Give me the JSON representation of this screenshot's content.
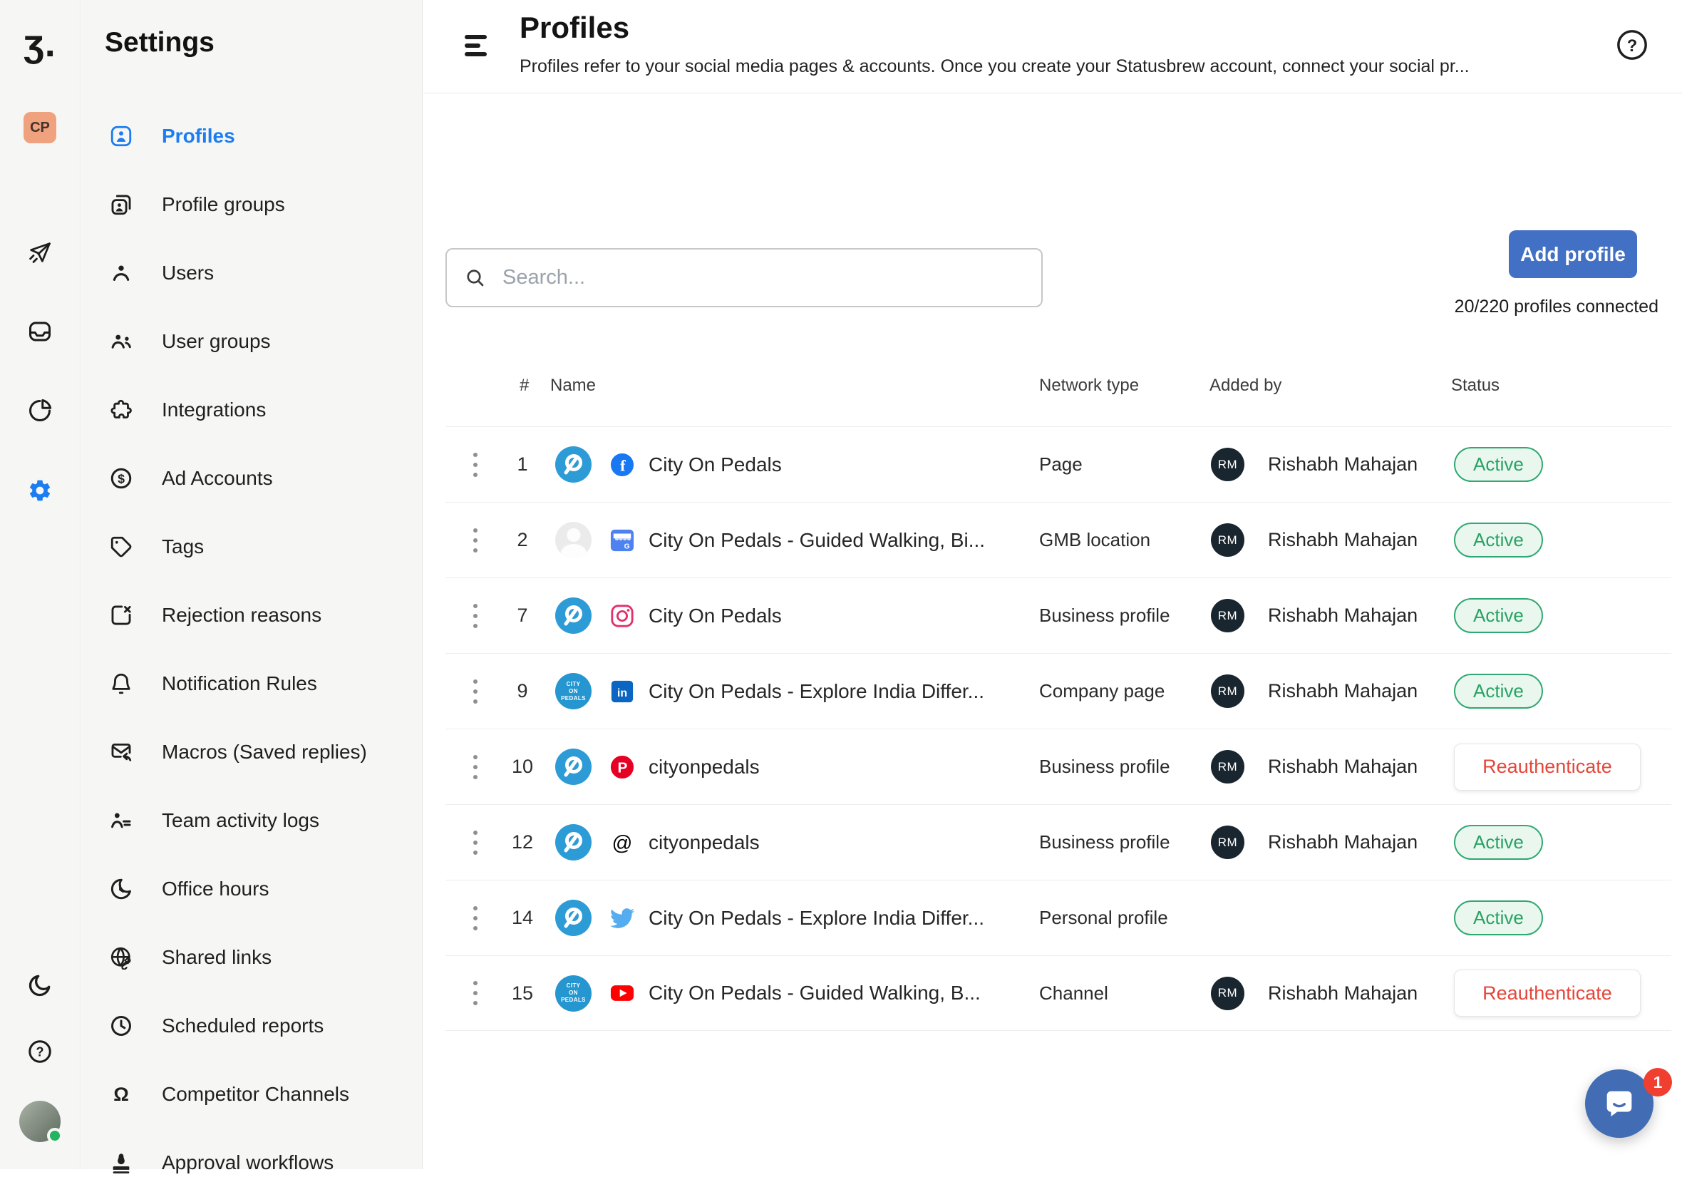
{
  "app": {
    "logo_glyph": "ʒ."
  },
  "rail": {
    "workspace_badge": "CP",
    "icons": [
      "paper-plane-icon",
      "inbox-icon",
      "pie-chart-icon",
      "gear-icon",
      "moon-icon",
      "help-icon",
      "user-avatar"
    ]
  },
  "sidebar": {
    "title": "Settings",
    "items": [
      {
        "label": "Profiles",
        "icon": "person-card",
        "active": true
      },
      {
        "label": "Profile groups",
        "icon": "profile-cards"
      },
      {
        "label": "Users",
        "icon": "user"
      },
      {
        "label": "User groups",
        "icon": "user-group"
      },
      {
        "label": "Integrations",
        "icon": "puzzle"
      },
      {
        "label": "Ad Accounts",
        "icon": "dollar-circle"
      },
      {
        "label": "Tags",
        "icon": "tag"
      },
      {
        "label": "Rejection reasons",
        "icon": "box-x"
      },
      {
        "label": "Notification Rules",
        "icon": "bell"
      },
      {
        "label": "Macros (Saved replies)",
        "icon": "envelope-reply"
      },
      {
        "label": "Team activity logs",
        "icon": "person-activity"
      },
      {
        "label": "Office hours",
        "icon": "clock-moon"
      },
      {
        "label": "Shared links",
        "icon": "globe-link"
      },
      {
        "label": "Scheduled reports",
        "icon": "clock"
      },
      {
        "label": "Competitor Channels",
        "icon": "bust"
      },
      {
        "label": "Approval workflows",
        "icon": "stamp"
      }
    ]
  },
  "header": {
    "title": "Profiles",
    "subtitle": "Profiles refer to your social media pages & accounts. Once you create your Statusbrew account, connect your social pr..."
  },
  "toolbar": {
    "search_placeholder": "Search...",
    "add_profile_label": "Add profile",
    "connected_count": "20/220 profiles connected"
  },
  "table": {
    "columns": [
      "#",
      "Name",
      "Network type",
      "Added by",
      "Status"
    ],
    "avatar_text_lines": [
      "CITY",
      "ON",
      "PEDALS"
    ],
    "rows": [
      {
        "num": "1",
        "avatar": "logo",
        "network": "facebook",
        "name": "City On Pedals",
        "network_type": "Page",
        "added_by": "Rishabh Mahajan",
        "added_by_initials": "RM",
        "status": "Active",
        "status_kind": "active"
      },
      {
        "num": "2",
        "avatar": "placeholder",
        "network": "gmb",
        "name": "City On Pedals - Guided Walking, Bi...",
        "network_type": "GMB location",
        "added_by": "Rishabh Mahajan",
        "added_by_initials": "RM",
        "status": "Active",
        "status_kind": "active"
      },
      {
        "num": "7",
        "avatar": "logo",
        "network": "instagram",
        "name": "City On Pedals",
        "network_type": "Business profile",
        "added_by": "Rishabh Mahajan",
        "added_by_initials": "RM",
        "status": "Active",
        "status_kind": "active"
      },
      {
        "num": "9",
        "avatar": "cop-text",
        "network": "linkedin",
        "name": "City On Pedals - Explore India Differ...",
        "network_type": "Company page",
        "added_by": "Rishabh Mahajan",
        "added_by_initials": "RM",
        "status": "Active",
        "status_kind": "active"
      },
      {
        "num": "10",
        "avatar": "logo",
        "network": "pinterest",
        "name": "cityonpedals",
        "network_type": "Business profile",
        "added_by": "Rishabh Mahajan",
        "added_by_initials": "RM",
        "status": "Reauthenticate",
        "status_kind": "reauth"
      },
      {
        "num": "12",
        "avatar": "logo",
        "network": "threads",
        "name": "cityonpedals",
        "network_type": "Business profile",
        "added_by": "Rishabh Mahajan",
        "added_by_initials": "RM",
        "status": "Active",
        "status_kind": "active"
      },
      {
        "num": "14",
        "avatar": "logo",
        "network": "twitter",
        "name": "City On Pedals - Explore India Differ...",
        "network_type": "Personal profile",
        "added_by": "",
        "added_by_initials": "",
        "status": "Active",
        "status_kind": "active"
      },
      {
        "num": "15",
        "avatar": "cop-text",
        "network": "youtube",
        "name": "City On Pedals - Guided Walking, B...",
        "network_type": "Channel",
        "added_by": "Rishabh Mahajan",
        "added_by_initials": "RM",
        "status": "Reauthenticate",
        "status_kind": "reauth"
      }
    ]
  },
  "chat": {
    "unread_badge": "1"
  },
  "colors": {
    "accent_blue": "#1b7df1",
    "add_button_blue": "#4270c4",
    "active_green": "#28a263",
    "reauth_red": "#e4463a",
    "brand_avatar_blue": "#2d9bd5",
    "rm_avatar_navy": "#19262f",
    "intercom_blue": "#426cb3",
    "badge_red": "#f03e31",
    "workspace_badge_peach": "#f0a17e"
  }
}
